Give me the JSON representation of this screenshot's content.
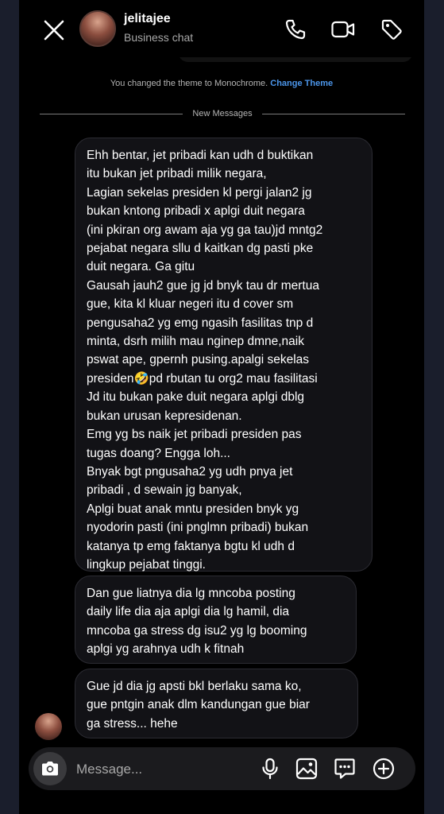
{
  "header": {
    "contact_name": "jelitajee",
    "contact_subtitle": "Business chat",
    "icons": {
      "close": "close-icon",
      "avatar": "profile-photo",
      "call": "phone-icon",
      "video": "video-camera-icon",
      "label": "tag-icon"
    }
  },
  "system": {
    "theme_message": "You changed the theme to Monochrome.",
    "theme_link": "Change Theme",
    "new_messages_label": "New Messages"
  },
  "messages": [
    {
      "sender": "jelitajee",
      "text": "Ehh bentar, jet pribadi kan udh d buktikan\nitu bukan jet pribadi milik negara,\nLagian sekelas presiden kl pergi jalan2 jg\nbukan kntong pribadi x aplgi duit negara\n(ini pkiran org awam aja yg ga tau)jd mntg2\npejabat negara sllu d kaitkan dg pasti pke\nduit negara. Ga gitu\nGausah jauh2 gue jg jd bnyk tau dr mertua\ngue, kita kl kluar negeri itu d cover sm\npengusaha2 yg emg ngasih fasilitas tnp d\nminta, dsrh milih mau nginep dmne,naik\npswat ape, gpernh pusing.apalgi sekelas\npresiden🤣pd rbutan tu org2 mau fasilitasi\nJd itu bukan pake duit negara aplgi dblg\nbukan urusan kepresidenan.\nEmg yg bs naik jet pribadi presiden pas\ntugas doang? Engga loh...\nBnyak bgt pngusaha2 yg udh pnya jet\npribadi , d sewain jg banyak,\nAplgi buat anak mntu presiden bnyk yg\nnyodorin pasti (ini pnglmn pribadi) bukan\nkatanya tp emg faktanya bgtu kl udh d\nlingkup pejabat tinggi."
    },
    {
      "sender": "jelitajee",
      "text": "Dan gue liatnya dia lg mncoba posting\ndaily life dia aja aplgi dia lg hamil, dia\nmncoba ga stress dg isu2 yg lg booming\naplgi yg arahnya udh k fitnah"
    },
    {
      "sender": "jelitajee",
      "text": "Gue jd dia jg apsti bkl berlaku sama ko,\ngue pntgin anak dlm kandungan gue biar\nga stress... hehe"
    }
  ],
  "composer": {
    "placeholder": "Message...",
    "icons": [
      "camera-icon",
      "microphone-icon",
      "gallery-icon",
      "sticker-icon",
      "plus-icon"
    ]
  },
  "colors": {
    "background": "#000000",
    "bubble": "#121216",
    "link": "#4b95e9",
    "muted_text": "#a8a8a8"
  }
}
